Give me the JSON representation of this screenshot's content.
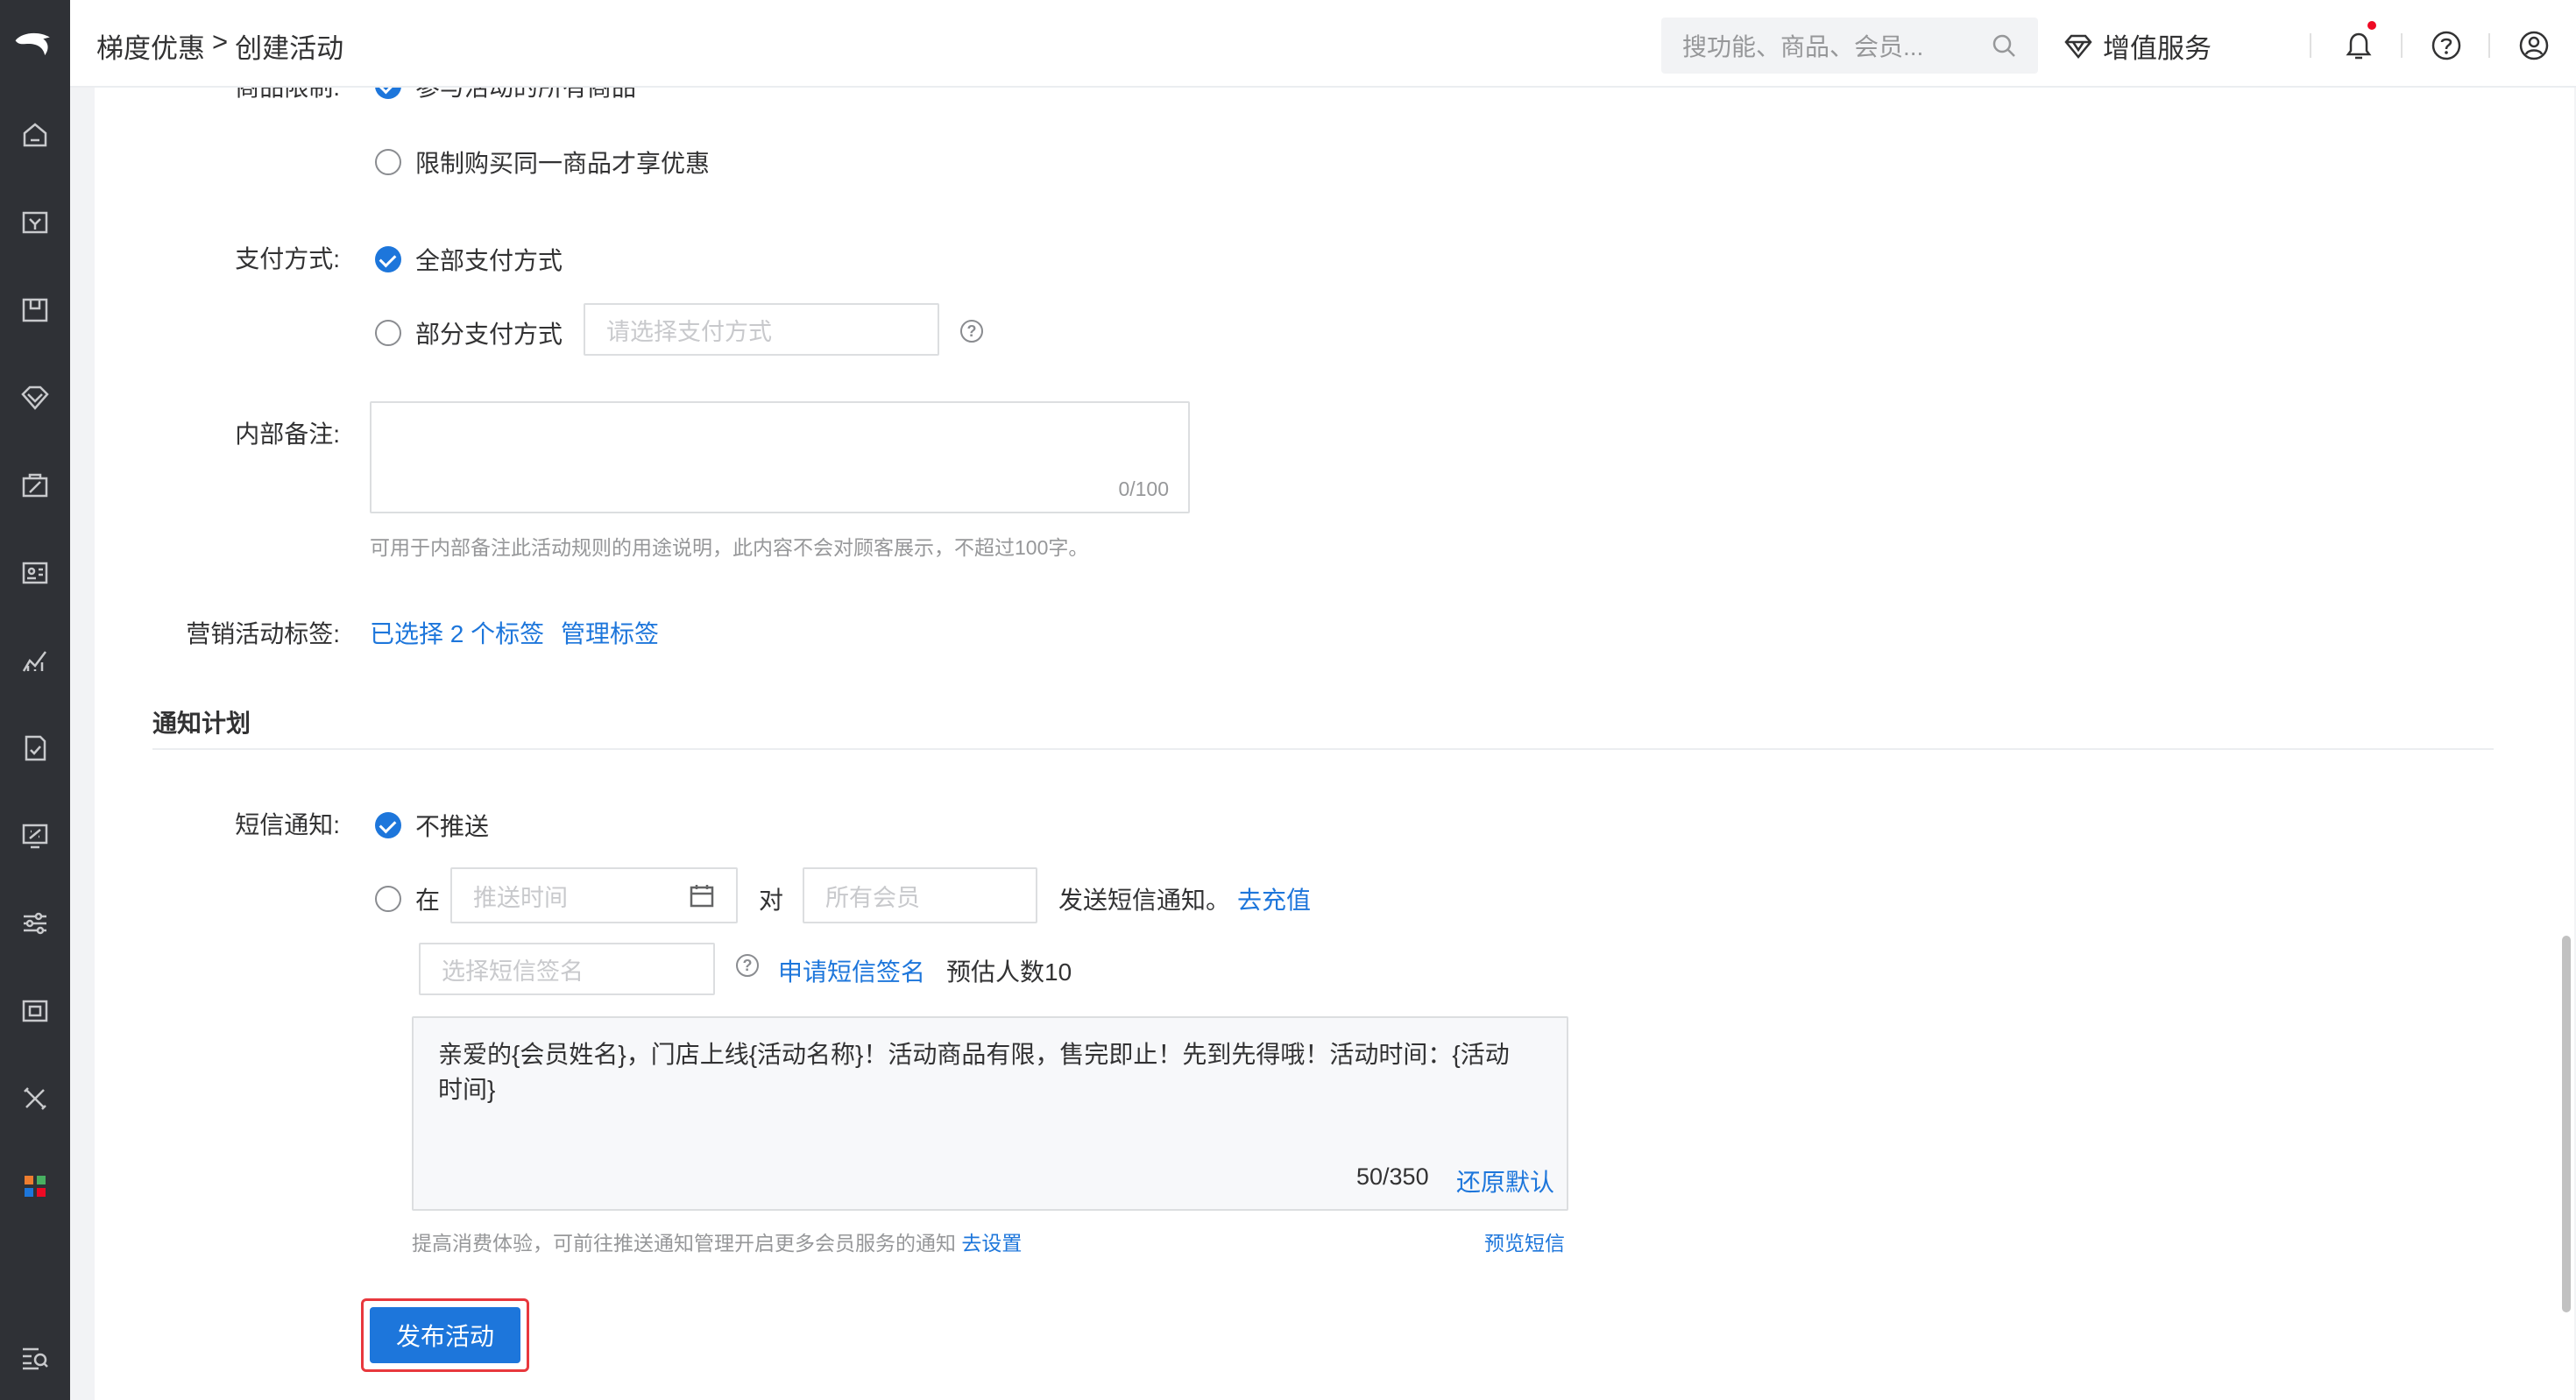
{
  "header": {
    "breadcrumb_home": "梯度优惠",
    "breadcrumb_sep": ">",
    "breadcrumb_current": "创建活动",
    "search_placeholder": "搜功能、商品、会员...",
    "value_added_service": "增值服务"
  },
  "form": {
    "goods_limit": {
      "label": "商品限制:",
      "option_all": "参与活动的所有商品",
      "option_same": "限制购买同一商品才享优惠"
    },
    "payment": {
      "label": "支付方式:",
      "option_all": "全部支付方式",
      "option_partial": "部分支付方式",
      "partial_placeholder": "请选择支付方式",
      "help": "?"
    },
    "remark": {
      "label": "内部备注:",
      "counter": "0/100",
      "hint": "可用于内部备注此活动规则的用途说明，此内容不会对顾客展示，不超过100字。"
    },
    "tags": {
      "label": "营销活动标签:",
      "selected": "已选择 2 个标签",
      "manage": "管理标签"
    }
  },
  "notify": {
    "section_title": "通知计划",
    "sms": {
      "label": "短信通知:",
      "option_none": "不推送",
      "option_at": "在",
      "time_placeholder": "推送时间",
      "to": "对",
      "member_placeholder": "所有会员",
      "send_text": "发送短信通知。",
      "recharge": "去充值",
      "signature_placeholder": "选择短信签名",
      "help": "?",
      "apply_signature": "申请短信签名",
      "estimate": "预估人数10",
      "message_line1": "亲爱的{会员姓名}，门店上线{活动名称}！活动商品有限，售完即止！先到先得哦！活动时间：{活动",
      "message_line2": "时间}",
      "message_counter": "50/350",
      "restore_default": "还原默认",
      "footer_hint": "提高消费体验，可前往推送通知管理开启更多会员服务的通知",
      "go_settings": "去设置",
      "preview": "预览短信"
    }
  },
  "actions": {
    "publish": "发布活动"
  },
  "colors": {
    "accent": "#1d76db",
    "sidebar": "#2f3136",
    "highlight": "#e8383d"
  }
}
